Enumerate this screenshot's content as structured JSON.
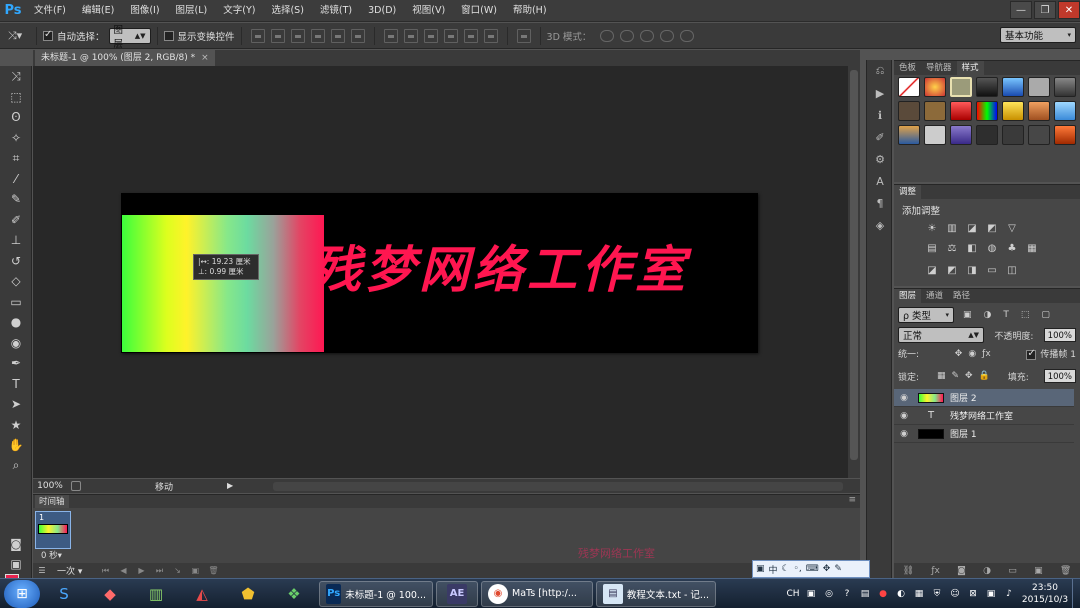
{
  "app": {
    "logo": "Ps",
    "menu": [
      "文件(F)",
      "编辑(E)",
      "图像(I)",
      "图层(L)",
      "文字(Y)",
      "选择(S)",
      "滤镜(T)",
      "3D(D)",
      "视图(V)",
      "窗口(W)",
      "帮助(H)"
    ],
    "window_controls": {
      "minimize": "—",
      "restore": "❐",
      "close": "✕"
    }
  },
  "options": {
    "auto_select_label": "自动选择：",
    "auto_select_value": "图层",
    "show_transform_label": "显示变换控件",
    "mode3d_label": "3D 模式：",
    "workspace": "基本功能"
  },
  "document": {
    "tab_title": "未标题-1 @ 100% (图层 2, RGB/8) *",
    "close_glyph": "×",
    "canvas_text": "残梦网络工作室",
    "measure_line1": "|↔: 19.23 厘米",
    "measure_line2": "⊥:  0.99 厘米"
  },
  "status": {
    "zoom": "100%",
    "text": "移动"
  },
  "timeline": {
    "tab": "时间轴",
    "frame_number": "1",
    "frame_delay": "0 秒▾",
    "loop": "一次",
    "loop_arrow": "▾"
  },
  "panels": {
    "styles_tabs": [
      "色板",
      "导航器",
      "样式"
    ],
    "adjust_tab": "调整",
    "adjust_title": "添加调整",
    "layers_tabs": [
      "图层",
      "通道",
      "路径"
    ],
    "filter_type": "ρ 类型",
    "blend_mode": "正常",
    "opacity_label": "不透明度:",
    "opacity_value": "100%",
    "unify_label": "统一:",
    "propagate_label": "传播帧 1",
    "lock_label": "锁定:",
    "fill_label": "填充:",
    "fill_value": "100%",
    "layers": [
      {
        "name": "图层 2",
        "type": "gradient",
        "selected": true
      },
      {
        "name": "残梦网络工作室",
        "type": "text",
        "selected": false
      },
      {
        "name": "图层 1",
        "type": "fill",
        "selected": false
      }
    ]
  },
  "overlay": {
    "watermark": "残梦网络工作室",
    "ime_text": "中"
  },
  "taskbar": {
    "tasks": [
      {
        "icon": "Ps",
        "label": "未标题-1 @ 100...",
        "icon_color": "#0a2a55",
        "icon_fg": "#31a8ff"
      },
      {
        "icon": "AE",
        "label": "",
        "icon_color": "#3a3a66",
        "icon_fg": "#c9c9ff"
      },
      {
        "icon": "◉",
        "label": "MaTs [http:/...",
        "icon_color": "#ffffff",
        "icon_fg": "#e04a2f"
      },
      {
        "icon": "▤",
        "label": "教程文本.txt - 记...",
        "icon_color": "#d6e6f5",
        "icon_fg": "#335"
      }
    ],
    "tray_lang": "CH",
    "time": "23:50",
    "date": "2015/10/3"
  },
  "colors": {
    "foreground": "#e8234f",
    "background": "#e5e5e5",
    "text_red": "#ff1650"
  }
}
